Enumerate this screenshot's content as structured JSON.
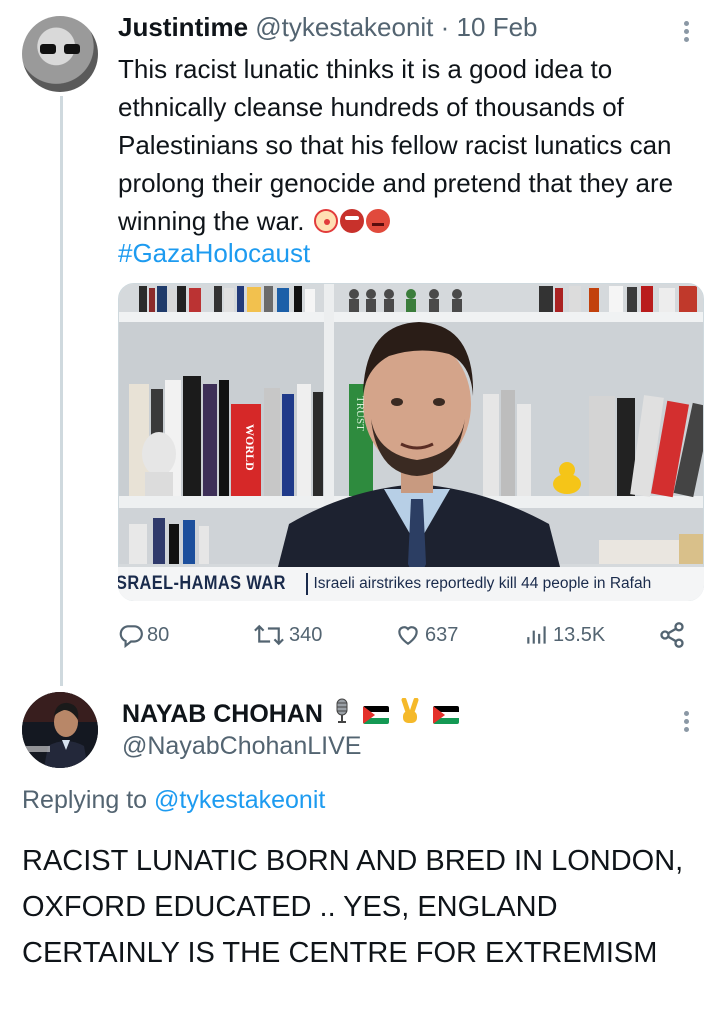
{
  "tweet1": {
    "author_name": "Justintime",
    "author_handle": "@tykestakeonit",
    "separator": "·",
    "date": "10 Feb",
    "text": "This racist lunatic thinks it is a good idea to ethnically cleanse hundreds of thousands of Palestinians so that his fellow racist lunatics can prolong their genocide and pretend that they are winning the war.",
    "emojis": [
      "clown-face-icon",
      "ogre-icon",
      "angry-face-icon"
    ],
    "hashtag": "#GazaHolocaust",
    "media": {
      "chyron_tag": "SRAEL-HAMAS WAR",
      "chyron_text": "Israeli airstrikes reportedly kill 44 people in Rafah",
      "book_spine_labels": [
        "WORLD",
        "TRUST"
      ]
    },
    "actions": {
      "replies": "80",
      "reposts": "340",
      "likes": "637",
      "views": "13.5K"
    }
  },
  "tweet2": {
    "author_name": "NAYAB CHOHAN",
    "author_handle": "@NayabChohanLIVE",
    "badges": [
      "microphone-icon",
      "palestine-flag-icon",
      "victory-hand-icon",
      "palestine-flag-icon"
    ],
    "replying_prefix": "Replying to",
    "replying_to": "@tykestakeonit",
    "text": "RACIST LUNATIC BORN AND BRED IN LONDON, OXFORD EDUCATED .. YES, ENGLAND CERTAINLY IS THE CENTRE FOR EXTREMISM"
  },
  "colors": {
    "link": "#1d9bf0",
    "secondary_text": "#536471",
    "primary_text": "#0f1419",
    "thread_line": "#cfd9de"
  }
}
